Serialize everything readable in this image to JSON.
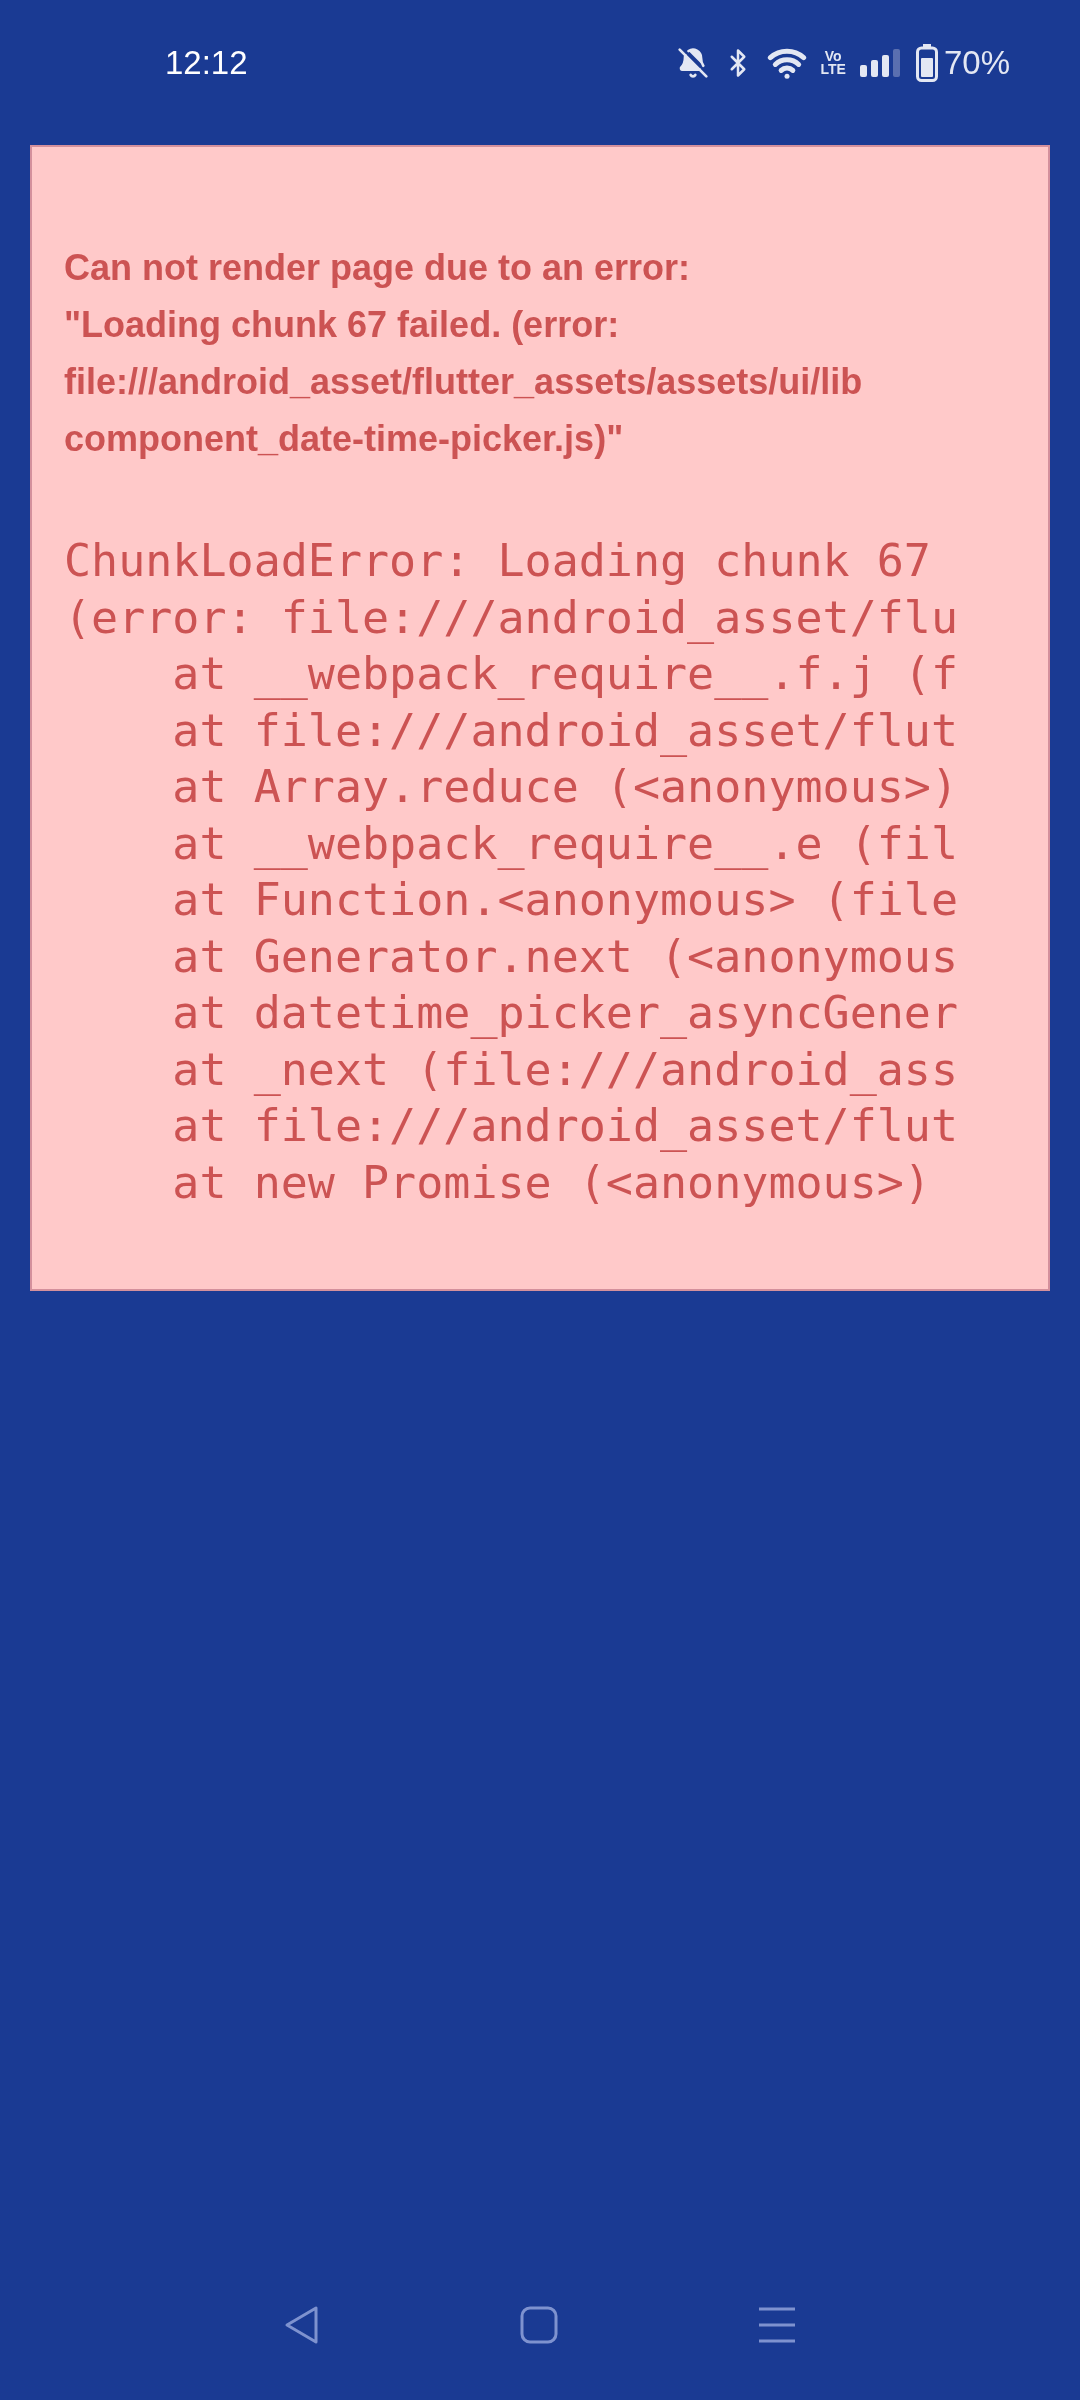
{
  "status_bar": {
    "time": "12:12",
    "network_label": [
      "Vo",
      "LTE"
    ],
    "battery": "70%"
  },
  "error": {
    "heading": "Can not render page due to an error:\n\"Loading chunk 67 failed. (error:\nfile:///android_asset/flutter_assets/assets/ui/lib\ncomponent_date-time-picker.js)\"",
    "stack": [
      "ChunkLoadError: Loading chunk 67",
      "(error: file:///android_asset/flu",
      "    at __webpack_require__.f.j (f",
      "    at file:///android_asset/flut",
      "    at Array.reduce (<anonymous>)",
      "    at __webpack_require__.e (fil",
      "    at Function.<anonymous> (file",
      "    at Generator.next (<anonymous",
      "    at datetime_picker_asyncGener",
      "    at _next (file:///android_ass",
      "    at file:///android_asset/flut",
      "    at new Promise (<anonymous>)"
    ]
  }
}
